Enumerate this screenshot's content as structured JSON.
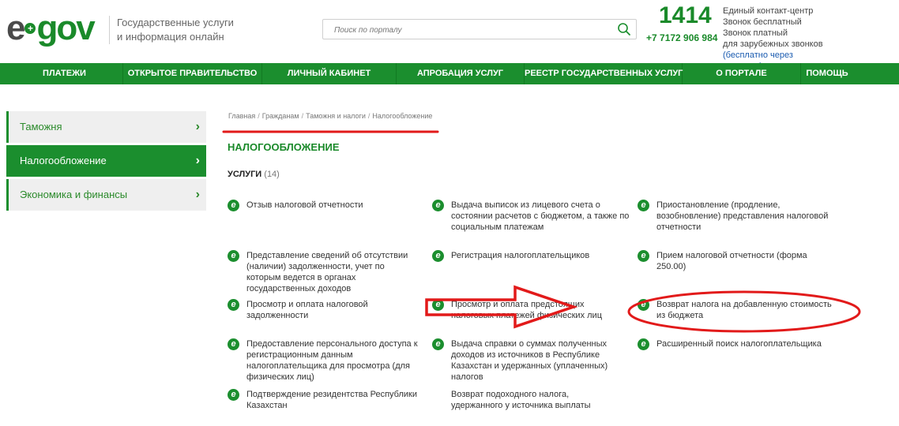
{
  "header": {
    "logo_e": "e",
    "logo_gov": "gov",
    "logo_plus": "+",
    "tagline_line1": "Государственные услуги",
    "tagline_line2": "и информация онлайн",
    "search_placeholder": "Поиск по порталу",
    "contact_number": "1414",
    "contact_phone": "+7 7172 906 984",
    "contact_line1": "Единый контакт-центр",
    "contact_line2": "Звонок бесплатный",
    "contact_line3": "Звонок платный",
    "contact_line4": "для зарубежных звонков",
    "contact_line5": "(бесплатно через интернет)"
  },
  "nav": {
    "items": [
      {
        "label": "ПЛАТЕЖИ"
      },
      {
        "label": "ОТКРЫТОЕ ПРАВИТЕЛЬСТВО"
      },
      {
        "label": "ЛИЧНЫЙ КАБИНЕТ"
      },
      {
        "label": "АПРОБАЦИЯ УСЛУГ"
      },
      {
        "label": "РЕЕСТР ГОСУДАРСТВЕННЫХ УСЛУГ"
      },
      {
        "label": "О ПОРТАЛЕ"
      },
      {
        "label": "ПОМОЩЬ"
      }
    ]
  },
  "sidebar": {
    "items": [
      {
        "label": "Таможня"
      },
      {
        "label": "Налогообложение"
      },
      {
        "label": "Экономика и финансы"
      }
    ],
    "chevron": "›"
  },
  "breadcrumb": {
    "items": [
      "Главная",
      "Гражданам",
      "Таможня и налоги",
      "Налогообложение"
    ],
    "separator": "/"
  },
  "main": {
    "title": "НАЛОГООБЛОЖЕНИЕ",
    "section_label": "УСЛУГИ",
    "section_count": "(14)",
    "badge": "e",
    "services": [
      {
        "text": "Отзыв налоговой отчетности"
      },
      {
        "text": "Выдача выписок из лицевого счета о состоянии расчетов с бюджетом, а также по социальным платежам"
      },
      {
        "text": "Приостановление (продление, возобновление) представления налоговой отчетности"
      },
      {
        "text": "Представление сведений об отсутствии (наличии) задолженности, учет по которым ведется в органах государственных доходов"
      },
      {
        "text": "Регистрация налогоплательщиков"
      },
      {
        "text": "Прием налоговой отчетности (форма 250.00)"
      },
      {
        "text": "Просмотр и оплата налоговой задолженности"
      },
      {
        "text": "Просмотр и оплата предстоящих налоговых платежей физических лиц"
      },
      {
        "text": "Возврат налога на добавленную стоимость из бюджета"
      },
      {
        "text": "Предоставление персонального доступа к регистрационным данным налогоплательщика для просмотра (для физических лиц)"
      },
      {
        "text": "Выдача справки о суммах полученных доходов из источников в Республике Казахстан и удержанных (уплаченных) налогов"
      },
      {
        "text": "Расширенный поиск налогоплательщика"
      },
      {
        "text": "Подтверждение резидентства Республики Казахстан"
      },
      {
        "text": "Возврат подоходного налога, удержанного у источника выплаты"
      }
    ]
  },
  "colors": {
    "brand_green": "#1b8e2e",
    "annotation_red": "#e21a1a"
  }
}
